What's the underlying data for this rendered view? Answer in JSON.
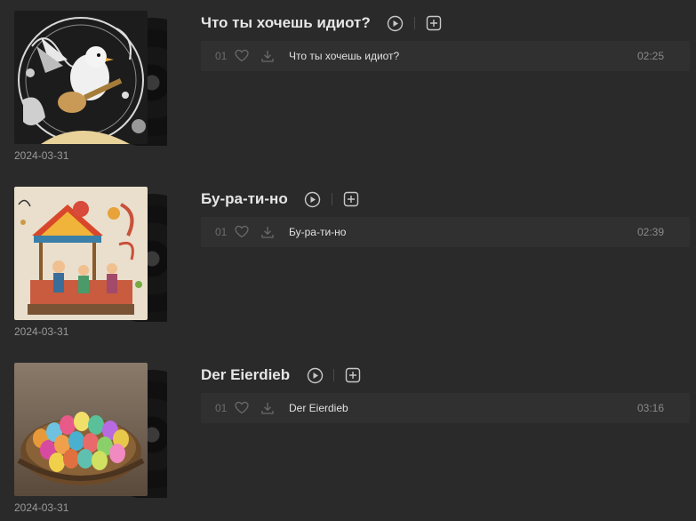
{
  "albums": [
    {
      "title": "Что ты хочешь идиот?",
      "date": "2024-03-31",
      "cover_theme": "bird-with-guitar",
      "tracks": [
        {
          "number": "01",
          "name": "Что ты хочешь идиот?",
          "duration": "02:25"
        }
      ]
    },
    {
      "title": "Бу-ра-ти-но",
      "date": "2024-03-31",
      "cover_theme": "carnival-carousel",
      "tracks": [
        {
          "number": "01",
          "name": "Бу-ра-ти-но",
          "duration": "02:39"
        }
      ]
    },
    {
      "title": "Der Eierdieb",
      "date": "2024-03-31",
      "cover_theme": "easter-eggs-nest",
      "tracks": [
        {
          "number": "01",
          "name": "Der Eierdieb",
          "duration": "03:16"
        }
      ]
    }
  ],
  "icons": {
    "play": "play-circle-icon",
    "add": "add-square-icon",
    "like": "heart-icon",
    "download": "download-icon"
  },
  "colors": {
    "background": "#2a2a2a",
    "track_row": "#303030",
    "text": "#e0e0e0",
    "muted": "#8a8a8a"
  }
}
